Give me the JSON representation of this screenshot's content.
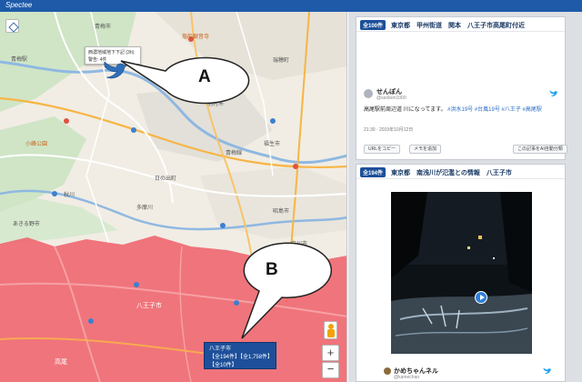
{
  "window": {
    "title": "Spectee"
  },
  "colors": {
    "accent": "#1e5aa8",
    "flood_area": "#f0606a",
    "water": "#3d7fd0"
  },
  "map": {
    "popup": {
      "line1": "西濃地域地下下記 (3h)",
      "line2": "警告: 4件"
    },
    "places": {
      "oume": "青梅市",
      "oume_station": "青梅駅",
      "hamura": "羽村市",
      "fussa": "福生市",
      "akiruno": "あきる野市",
      "akishima": "昭島市",
      "hachioji": "八王子市",
      "takao": "高尾",
      "akigawa": "秋川",
      "temple": "塩船観音寺",
      "park": "小峰公園",
      "hinode": "日の出町",
      "mizuho": "瑞穂町",
      "tachikawa": "立川市",
      "oume_line": "青梅線",
      "tama": "多摩川"
    },
    "area_popup": {
      "title": "八王子市",
      "body": "【全194件】【全1,758件】【全10件】"
    },
    "zoom_in": "+",
    "zoom_out": "−",
    "layer_icon": "layers-icon"
  },
  "callouts": {
    "a": "A",
    "b": "B"
  },
  "feed": {
    "cards": [
      {
        "count": "全100件",
        "header": "東京都　甲州街道　関本　八王子市高尾町付近",
        "user": "せんぽん",
        "handle": "@senbon1000",
        "text": "高尾駅前周辺道 川になってます。",
        "link": "#洪水19号 #台風19号 #八王子 #高尾駅",
        "time": "21:30 · 2019年10月12日",
        "buttons": [
          "URLをコピー",
          "メモを追加",
          "この記事をAI自動分類"
        ]
      },
      {
        "count": "全194件",
        "header": "東京都　南浅川が氾濫との情報　八王子市",
        "user": "かめちゃんネル",
        "handle": "@kamechan"
      }
    ]
  }
}
